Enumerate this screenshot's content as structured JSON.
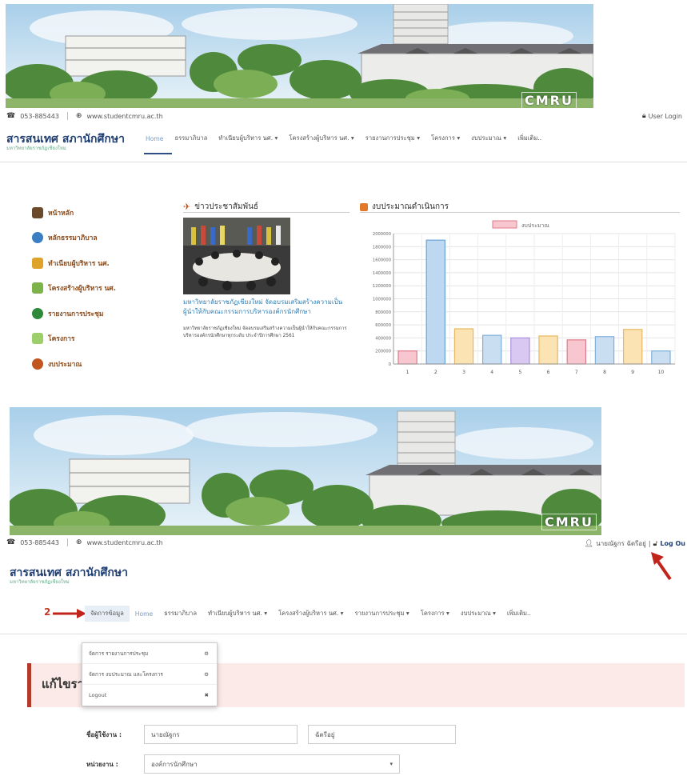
{
  "banner": {
    "logo": "CMRU"
  },
  "screen1": {
    "contact": {
      "phone": "053-885443",
      "website": "www.studentcmru.ac.th"
    },
    "login": "User Login",
    "brand": {
      "title": "สารสนเทศ สภานักศึกษา",
      "subtitle": "มหาวิทยาลัยราชภัฏเชียงใหม่"
    },
    "nav": [
      "Home",
      "ธรรมาภิบาล",
      "ทำเนียบผู้บริหาร นศ. ▾",
      "โครงสร้างผู้บริหาร นศ. ▾",
      "รายงานการประชุม ▾",
      "โครงการ ▾",
      "งบประมาณ ▾",
      "เพิ่มเติม.."
    ],
    "sidebar": [
      "หน้าหลัก",
      "หลักธรรมาภิบาล",
      "ทำเนียบผู้บริหาร นศ.",
      "โครงสร้างผู้บริหาร นศ.",
      "รายงานการประชุม",
      "โครงการ",
      "งบประมาณ"
    ],
    "news": {
      "heading": "ข่าวประชาสัมพันธ์",
      "title": "มหาวิทยาลัยราชภัฏเชียงใหม่ จัดอบรมเสริมสร้างความเป็นผู้นำให้กับคณะกรรมการบริหารองค์กรนักศึกษา",
      "body": "มหาวิทยาลัยราชภัฏเชียงใหม่ จัดอบรมเสริมสร้างความเป็นผู้นำให้กับคณะกรรมการบริหารองค์กรนักศึกษาทุกระดับ ประจำปีการศึกษา 2561"
    },
    "budget_heading": "งบประมาณดำเนินการ"
  },
  "chart_data": {
    "type": "bar",
    "title": "",
    "legend": [
      "งบประมาณ"
    ],
    "categories": [
      "1",
      "2",
      "3",
      "4",
      "5",
      "6",
      "7",
      "8",
      "9",
      "10"
    ],
    "values": [
      200000,
      1900000,
      540000,
      440000,
      400000,
      430000,
      370000,
      420000,
      530000,
      200000
    ],
    "ylim": [
      0,
      2000000
    ],
    "yticks": [
      "0",
      "200000",
      "400000",
      "600000",
      "800000",
      "1000000",
      "1200000",
      "1400000",
      "1600000",
      "1800000",
      "2000000"
    ],
    "bar_colors": [
      "#f7c6cf",
      "#bcd9f1",
      "#fbe3b4",
      "#c9def0",
      "#d9c9f2",
      "#fbe3b4",
      "#f7c6cf",
      "#c9def0",
      "#fbe3b4",
      "#c9def0"
    ],
    "legend_color": "#f7c6cf",
    "legend_placement": "top-center",
    "grid": true
  },
  "screen2": {
    "contact": {
      "phone": "053-885443",
      "website": "www.studentcmru.ac.th"
    },
    "user": "นายณัฐกร ฉัตรีอยู่",
    "logout_link": "Log Ou",
    "brand": {
      "title": "สารสนเทศ สภานักศึกษา",
      "subtitle": "มหาวิทยาลัยราชภัฏเชียงใหม่"
    },
    "annotation": "2",
    "nav": [
      "จัดการข้อมูล",
      "Home",
      "ธรรมาภิบาล",
      "ทำเนียบผู้บริหาร นศ. ▾",
      "โครงสร้างผู้บริหาร นศ. ▾",
      "รายงานการประชุม ▾",
      "โครงการ ▾",
      "งบประมาณ ▾",
      "เพิ่มเติม.."
    ],
    "dropdown": [
      {
        "label": "จัดการ รายงานการประชุม",
        "icon": "⚙"
      },
      {
        "label": "จัดการ งบประมาณ และโครงการ",
        "icon": "⚙"
      },
      {
        "label": "Logout",
        "icon": "✖"
      }
    ],
    "edit_title": "แก้ไขรา",
    "form": {
      "name_label": "ชื่อผู้ใช้งาน :",
      "first_name": "นายณัฐกร",
      "last_name": "ฉัตรีอยู่",
      "unit_label": "หน่วยงาน :",
      "unit_value": "องค์การนักศึกษา"
    }
  }
}
